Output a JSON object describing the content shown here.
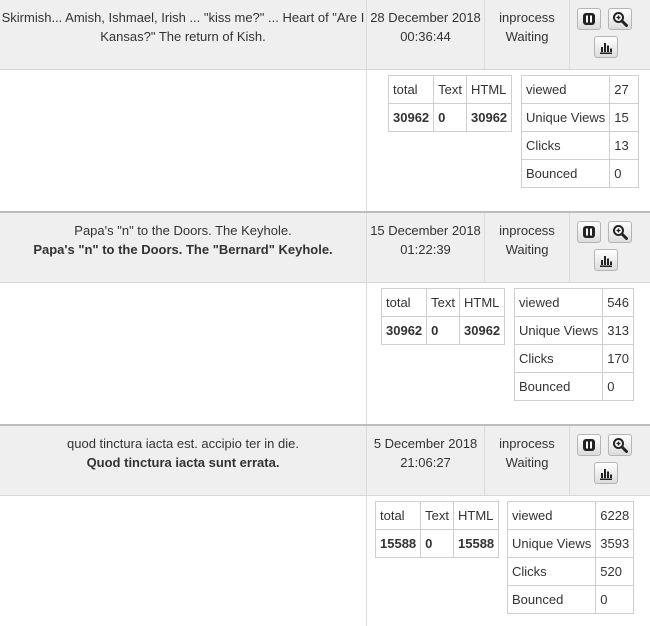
{
  "icons": {
    "pause": "pause-icon",
    "zoom": "zoom-icon",
    "stats": "bar-chart-icon"
  },
  "columns": {
    "total": "total",
    "text": "Text",
    "html": "HTML"
  },
  "view_labels": {
    "viewed": "viewed",
    "unique": "Unique Views",
    "clicks": "Clicks",
    "bounced": "Bounced"
  },
  "campaigns": [
    {
      "title": "Skirmish... Amish, Ishmael, Irish ... \"kiss me?\" ... Heart of \"Are I Kansas?\" The return of Kish.",
      "subject": "",
      "date": "28 December 2018",
      "time": "00:36:44",
      "status": "inprocess",
      "state": "Waiting",
      "total": "30962",
      "text": "0",
      "html": "30962",
      "viewed": "27",
      "unique": "15",
      "clicks": "13",
      "bounced": "0"
    },
    {
      "title": "Papa's \"n\" to the Doors. The Keyhole.",
      "subject": "Papa's \"n\" to the Doors. The \"Bernard\" Keyhole.",
      "date": "15 December 2018",
      "time": "01:22:39",
      "status": "inprocess",
      "state": "Waiting",
      "total": "30962",
      "text": "0",
      "html": "30962",
      "viewed": "546",
      "unique": "313",
      "clicks": "170",
      "bounced": "0"
    },
    {
      "title": "quod tinctura iacta est. accipio ter in die.",
      "subject": "Quod tinctura iacta sunt errata.",
      "date": "5 December 2018",
      "time": "21:06:27",
      "status": "inprocess",
      "state": "Waiting",
      "total": "15588",
      "text": "0",
      "html": "15588",
      "viewed": "6228",
      "unique": "3593",
      "clicks": "520",
      "bounced": "0"
    }
  ]
}
